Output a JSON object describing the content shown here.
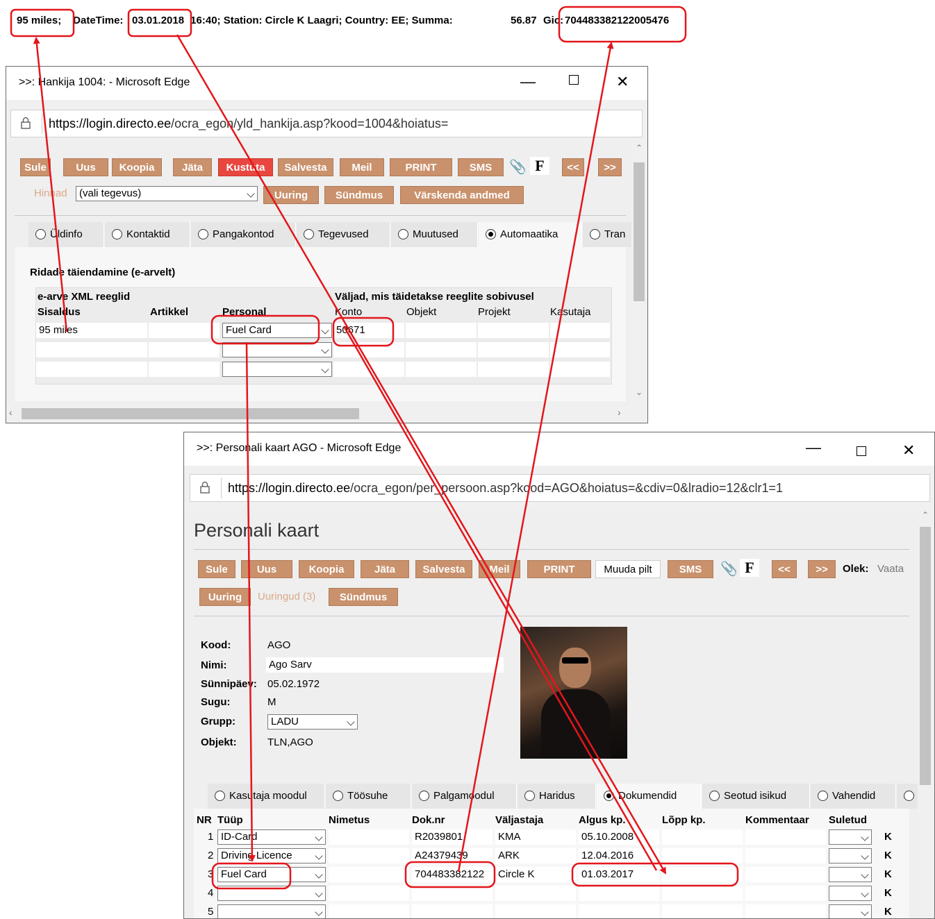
{
  "top_line": {
    "miles": "95 miles;",
    "datetime_label": " DateTime: ",
    "date": "03.01.2018",
    "rest": " 16:40; Station: Circle K Laagri; Country: EE; Summa:",
    "amount": "56.87",
    "gic_label": "Gic:",
    "gic_value": "704483382122005476"
  },
  "win1": {
    "title": ">>: Hankija 1004: - Microsoft Edge",
    "url_domain": "https://login.directo.ee",
    "url_path": "/ocra_egon/yld_hankija.asp?kood=1004&hoiatus=",
    "buttons": [
      "Sule",
      "Uus",
      "Koopia",
      "Jäta",
      "Kustuta",
      "Salvesta",
      "Meil",
      "PRINT",
      "SMS"
    ],
    "f_label": "F",
    "nav_prev": "<<",
    "nav_next": ">>",
    "hinnad_label": "Hinnad",
    "action_select": "(vali tegevus)",
    "buttons2": [
      "Uuring",
      "Sündmus",
      "Värskenda andmed"
    ],
    "tabs": [
      "Üldinfo",
      "Kontaktid",
      "Pangakontod",
      "Tegevused",
      "Muutused",
      "Automaatika",
      "Tran"
    ],
    "section_title": "Ridade täiendamine (e-arvelt)",
    "group1_title": "e-arve XML reeglid",
    "group2_title": "Väljad, mis täidetakse reeglite sobivusel",
    "columns": [
      "Sisaldus",
      "Artikkel",
      "Personal",
      "Konto",
      "Objekt",
      "Projekt",
      "Kasutaja"
    ],
    "rows": [
      {
        "sisaldus": "95 miles",
        "artikkel": "",
        "personal": "Fuel Card",
        "konto": "50671",
        "objekt": "",
        "projekt": "",
        "kasutaja": ""
      },
      {
        "sisaldus": "",
        "artikkel": "",
        "personal": "",
        "konto": "",
        "objekt": "",
        "projekt": "",
        "kasutaja": ""
      },
      {
        "sisaldus": "",
        "artikkel": "",
        "personal": "",
        "konto": "",
        "objekt": "",
        "projekt": "",
        "kasutaja": ""
      }
    ]
  },
  "win2": {
    "title": ">>: Personali kaart AGO - Microsoft Edge",
    "url_domain": "https://login.directo.ee",
    "url_path": "/ocra_egon/per_persoon.asp?kood=AGO&hoiatus=&cdiv=0&lradio=12&clr1=1",
    "page_title": "Personali kaart",
    "buttons": [
      "Sule",
      "Uus",
      "Koopia",
      "Jäta",
      "Salvesta",
      "Meil",
      "PRINT",
      "Muuda pilt",
      "SMS"
    ],
    "f_label": "F",
    "nav_prev": "<<",
    "nav_next": ">>",
    "olek_label": "Olek:",
    "olek_value": "Vaata",
    "uuring": "Uuring",
    "uuringud": "Uuringud (3)",
    "syndmus": "Sündmus",
    "fields": {
      "kood_label": "Kood:",
      "kood": "AGO",
      "nimi_label": "Nimi:",
      "nimi": "Ago Sarv",
      "synnipaev_label": "Sünnipäev:",
      "synnipaev": "05.02.1972",
      "sugu_label": "Sugu:",
      "sugu": "M",
      "grupp_label": "Grupp:",
      "grupp": "LADU",
      "objekt_label": "Objekt:",
      "objekt": "TLN,AGO"
    },
    "tabs": [
      "Kasutaja moodul",
      "Töösuhe",
      "Palgamoodul",
      "Haridus",
      "Dokumendid",
      "Seotud isikud",
      "Vahendid"
    ],
    "columns": [
      "NR",
      "Tüüp",
      "Nimetus",
      "Dok.nr",
      "Väljastaja",
      "Algus kp.",
      "Lõpp kp.",
      "Kommentaar",
      "Suletud"
    ],
    "rows": [
      {
        "nr": "1",
        "tyyp": "ID-Card",
        "nimetus": "",
        "doknr": "R2039801",
        "valjastaja": "KMA",
        "algus": "05.10.2008",
        "lopp": "",
        "kommentaar": "",
        "k": "K"
      },
      {
        "nr": "2",
        "tyyp": "Driving Licence",
        "nimetus": "",
        "doknr": "A24379439",
        "valjastaja": "ARK",
        "algus": "12.04.2016",
        "lopp": "",
        "kommentaar": "",
        "k": "K"
      },
      {
        "nr": "3",
        "tyyp": "Fuel Card",
        "nimetus": "",
        "doknr": "704483382122",
        "valjastaja": "Circle K",
        "algus": "01.03.2017",
        "lopp": "",
        "kommentaar": "",
        "k": "K"
      },
      {
        "nr": "4",
        "tyyp": "",
        "nimetus": "",
        "doknr": "",
        "valjastaja": "",
        "algus": "",
        "lopp": "",
        "kommentaar": "",
        "k": "K"
      },
      {
        "nr": "5",
        "tyyp": "",
        "nimetus": "",
        "doknr": "",
        "valjastaja": "",
        "algus": "",
        "lopp": "",
        "kommentaar": "",
        "k": "K"
      }
    ]
  },
  "annotation_color": "#e3161b",
  "button_color": "#c9916c"
}
